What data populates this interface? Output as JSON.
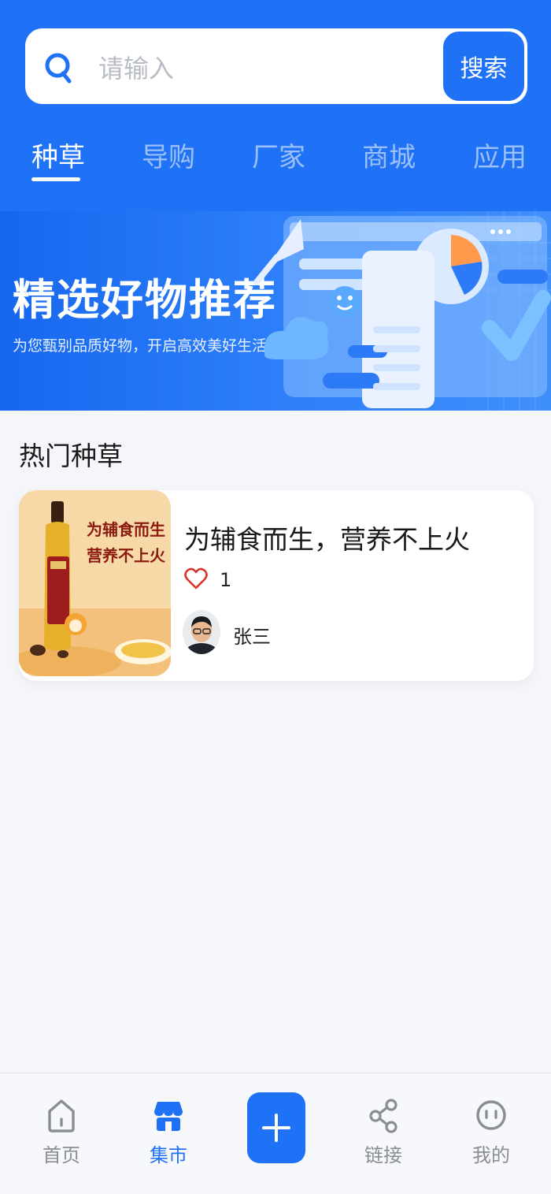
{
  "search": {
    "placeholder": "请输入",
    "button_label": "搜索"
  },
  "tabs": [
    {
      "label": "种草",
      "active": true
    },
    {
      "label": "导购",
      "active": false
    },
    {
      "label": "厂家",
      "active": false
    },
    {
      "label": "商城",
      "active": false
    },
    {
      "label": "应用",
      "active": false
    }
  ],
  "banner": {
    "title": "精选好物推荐",
    "subtitle": "为您甄别品质好物，开启高效美好生活"
  },
  "section": {
    "title": "热门种草"
  },
  "card": {
    "image_text_line1": "为辅食而生",
    "image_text_line2": "营养不上火",
    "title": "为辅食而生，营养不上火",
    "likes": "1",
    "author": "张三"
  },
  "bottom_nav": [
    {
      "label": "首页",
      "icon": "home-icon",
      "active": false
    },
    {
      "label": "集市",
      "icon": "market-icon",
      "active": true
    },
    {
      "label": "",
      "icon": "plus-icon",
      "active": false
    },
    {
      "label": "链接",
      "icon": "share-icon",
      "active": false
    },
    {
      "label": "我的",
      "icon": "profile-icon",
      "active": false
    }
  ],
  "colors": {
    "primary": "#1f72f5",
    "background": "#f4f6fa",
    "heart": "#d9342b"
  }
}
